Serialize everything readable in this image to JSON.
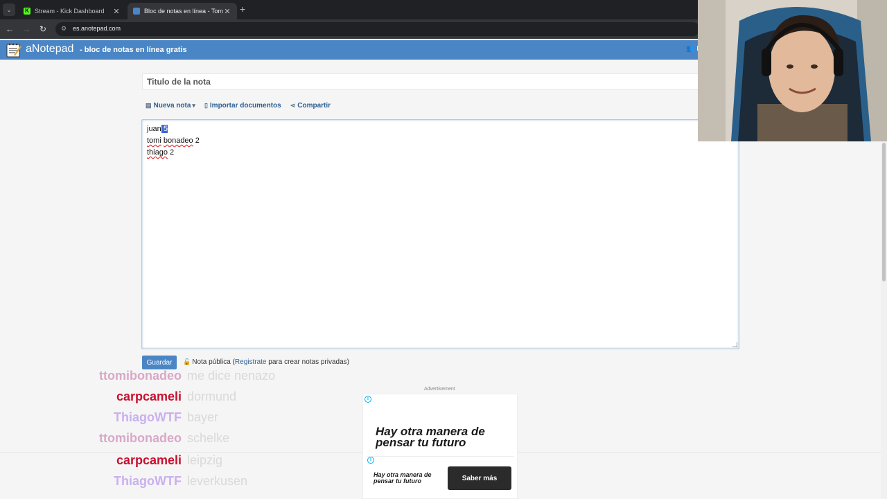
{
  "browser": {
    "tabs": [
      {
        "title": "Stream - Kick Dashboard",
        "favicon": "kick-logo",
        "active": false
      },
      {
        "title": "Bloc de notas en línea - Toma y",
        "favicon": "anotepad-logo",
        "active": true
      }
    ],
    "address": "es.anotepad.com",
    "kick_favicon_letter": "K"
  },
  "header": {
    "brand": "aNotepad",
    "tagline": "- bloc de notas en línea gratis",
    "color": "#4a86c5"
  },
  "note": {
    "title_placeholder": "Titulo de la nota",
    "actions": {
      "new": "Nueva nota",
      "import": "Importar documentos",
      "share": "Compartir"
    },
    "lines": {
      "l1_pre": "juan",
      "l1_sel": " 5",
      "l2_a": "tomi",
      "l2_b": "bonadeo",
      "l2_c": "2",
      "l3_a": "thiago",
      "l3_b": "2"
    },
    "save": "Guardar",
    "privacy_pre": "Nota pública (",
    "privacy_link": "Registrate",
    "privacy_post": " para crear notas privadas)"
  },
  "ad": {
    "label": "Advertisement",
    "headline": "Hay otra manera de pensar tu futuro",
    "card_text": "Hay otra manera de pensar tu futuro",
    "cta": "Saber más",
    "info_glyph": "i"
  },
  "chat": [
    {
      "user": "ttomibonadeo",
      "msg": "me dice nenazo",
      "user_color": "#d9a8c8"
    },
    {
      "user": "carpcameli",
      "msg": "dormund",
      "user_color": "#c8102e"
    },
    {
      "user": "ThiagoWTF",
      "msg": "bayer",
      "user_color": "#c9b0ee"
    },
    {
      "user": "ttomibonadeo",
      "msg": "schelke",
      "user_color": "#d9a8c8"
    },
    {
      "user": "carpcameli",
      "msg": "leipzig",
      "user_color": "#c8102e"
    },
    {
      "user": "ThiagoWTF",
      "msg": "leverkusen",
      "user_color": "#c9b0ee"
    }
  ]
}
